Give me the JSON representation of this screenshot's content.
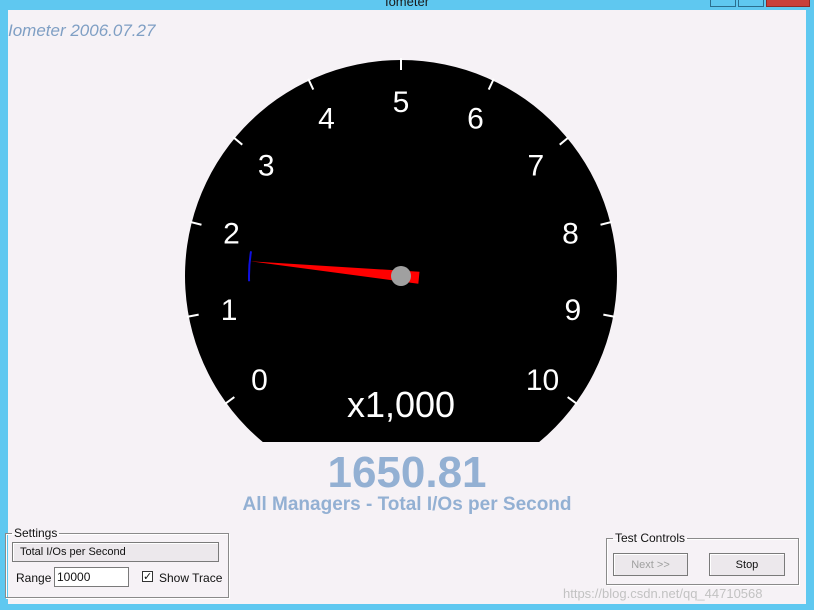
{
  "window": {
    "title": "Iometer"
  },
  "version": "Iometer 2006.07.27",
  "gauge": {
    "tick_labels": [
      "0",
      "1",
      "2",
      "3",
      "4",
      "5",
      "6",
      "7",
      "8",
      "9",
      "10"
    ],
    "multiplier_label": "x1,000",
    "value": 1650.81,
    "trace_max": 1800,
    "trace_min": 1350,
    "range": 10000,
    "colors": {
      "face": "#000000",
      "needle": "#ff0000",
      "trace": "#1010e0",
      "hub": "#a0a0a0",
      "text": "#ffffff"
    }
  },
  "readout": {
    "value_text": "1650.81",
    "label": "All Managers - Total I/Os per Second",
    "color": "#93b0d3"
  },
  "settings": {
    "legend": "Settings",
    "metric_button": "Total I/Os per Second",
    "range_label": "Range",
    "range_value": "10000",
    "show_trace_label": "Show Trace",
    "show_trace_checked": true
  },
  "test_controls": {
    "legend": "Test Controls",
    "next_label": "Next >>",
    "stop_label": "Stop"
  },
  "watermark": "https://blog.csdn.net/qq_44710568"
}
